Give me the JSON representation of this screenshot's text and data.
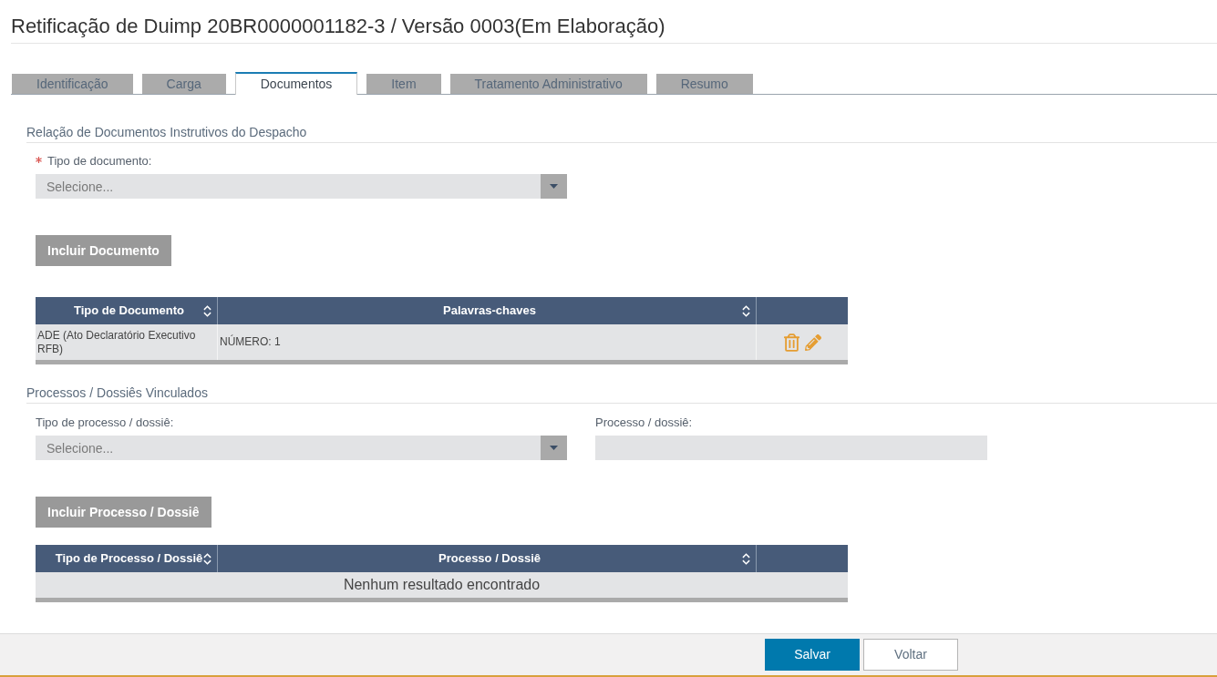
{
  "page_title": "Retificação de Duimp 20BR0000001182-3 / Versão 0003(Em Elaboração)",
  "tabs": [
    {
      "label": "Identificação",
      "selected": false
    },
    {
      "label": "Carga",
      "selected": false
    },
    {
      "label": "Documentos",
      "selected": true
    },
    {
      "label": "Item",
      "selected": false
    },
    {
      "label": "Tratamento Administrativo",
      "selected": false
    },
    {
      "label": "Resumo",
      "selected": false
    }
  ],
  "documents": {
    "heading": "Relação de Documentos Instrutivos do Despacho",
    "document_type": {
      "label": "Tipo de documento:",
      "required": true,
      "placeholder": "Selecione..."
    },
    "add_button": "Incluir Documento",
    "table": {
      "columns": [
        {
          "label": "Tipo de Documento",
          "sortable": true
        },
        {
          "label": "Palavras-chaves",
          "sortable": true
        }
      ],
      "rows": [
        {
          "cells": [
            "ADE (Ato Declaratório Executivo RFB)",
            "NÚMERO: 1"
          ]
        }
      ]
    }
  },
  "processes": {
    "heading": "Processos / Dossiês Vinculados",
    "process_type": {
      "label": "Tipo de processo / dossiê:",
      "placeholder": "Selecione..."
    },
    "process": {
      "label": "Processo / dossiê:"
    },
    "add_button": "Incluir Processo / Dossiê",
    "table": {
      "columns": [
        {
          "label": "Tipo de Processo / Dossiê",
          "sortable": true
        },
        {
          "label": "Processo / Dossiê",
          "sortable": true
        }
      ],
      "empty_message": "Nenhum resultado encontrado"
    }
  },
  "footer": {
    "actions": [
      {
        "label": "Salvar",
        "kind": "primary"
      },
      {
        "label": "Voltar",
        "kind": "secondary"
      }
    ]
  }
}
